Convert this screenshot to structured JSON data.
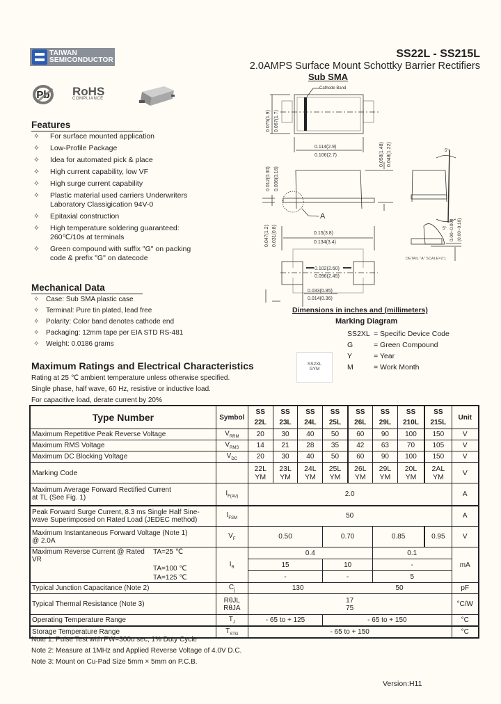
{
  "header": {
    "company_line1": "TAIWAN",
    "company_line2": "SEMICONDUCTOR",
    "part_range": "SS22L - SS215L",
    "description": "2.0AMPS Surface Mount Schottky Barrier Rectifiers",
    "package": "Sub SMA",
    "pb_free_icon": "Pb",
    "rohs": "RoHS",
    "rohs_sub": "COMPLIANCE"
  },
  "drawing": {
    "cathode_band": "Cathode Band",
    "dim_width_top": "0.114(2.9)",
    "dim_width_bot": "0.106(2.7)",
    "dim_height_top": "0.075(1.9)",
    "dim_height_bot": "0.067(1.7)",
    "dim_body_h_top": "0.058(1.48)",
    "dim_body_h_bot": "0.048(1.22)",
    "dim_lead_t_top": "0.012(0.30)",
    "dim_lead_t_bot": "0.006(0.16)",
    "detail_marker": "A",
    "angle_top": "5°",
    "angle_bot": "5°",
    "dim_len_top": "0.15(3.8)",
    "dim_len_bot": "0.134(3.4)",
    "dim_pad_top": "0.047(1.2)",
    "dim_pad_bot": "0.031(0.8)",
    "dim_inner_top": "0.102(2.60)",
    "dim_inner_bot": "0.096(2.45)",
    "dim_lead_top": "0.033(0.85)",
    "dim_lead_bot": "0.014(0.36)",
    "detail_dim_top": "0.00~0.004",
    "detail_dim_bot": "(0.00~0.10)",
    "detail_caption": "DETAIL \"A\" SCALE=2:1",
    "units_note": "Dimensions in inches and (millimeters)"
  },
  "features": {
    "heading": "Features",
    "items": [
      "For surface mounted application",
      "Low-Profile Package",
      "Idea for automated pick & place",
      "High current capability, low VF",
      "High surge current capability",
      "Plastic material used carriers Underwriters Laboratory Classigication 94V-0",
      "Epitaxial construction",
      "High temperature soldering guaranteed: 260℃/10s at terminals",
      "Green compound with suffix \"G\" on packing code & prefix \"G\" on datecode"
    ]
  },
  "mechanical": {
    "heading": "Mechanical Data",
    "items": [
      "Case: Sub SMA plastic case",
      "Terminal: Pure tin plated, lead free",
      "Polarity: Color band denotes cathode end",
      "Packaging: 12mm tape per EIA STD RS-481",
      "Weight: 0.0186 grams"
    ]
  },
  "marking": {
    "heading": "Marking Diagram",
    "chip_line1": "SS2XL",
    "chip_line2": "GYM",
    "legend": [
      {
        "code": "SS2XL",
        "meaning": "= Specific Device Code"
      },
      {
        "code": "G",
        "meaning": "= Green Compound"
      },
      {
        "code": "Y",
        "meaning": "= Year"
      },
      {
        "code": "M",
        "meaning": "= Work Month"
      }
    ]
  },
  "ratings": {
    "heading": "Maximum Ratings and Electrical Characteristics",
    "notes_top": [
      "Rating at 25 ℃ ambient temperature unless otherwise specified.",
      "Single phase, half wave, 60 Hz, resistive or inductive load.",
      "For capacitive load, derate current by 20%"
    ]
  },
  "table": {
    "type_header": "Type Number",
    "symbol_header": "Symbol",
    "unit_header": "Unit",
    "parts": [
      {
        "l1": "SS",
        "l2": "22L"
      },
      {
        "l1": "SS",
        "l2": "23L"
      },
      {
        "l1": "SS",
        "l2": "24L"
      },
      {
        "l1": "SS",
        "l2": "25L"
      },
      {
        "l1": "SS",
        "l2": "26L"
      },
      {
        "l1": "SS",
        "l2": "29L"
      },
      {
        "l1": "SS",
        "l2": "210L"
      },
      {
        "l1": "SS",
        "l2": "215L"
      }
    ],
    "vrrm": {
      "label": "Maximum Repetitive Peak Reverse Voltage",
      "sym": "V",
      "sub": "RRM",
      "values": [
        "20",
        "30",
        "40",
        "50",
        "60",
        "90",
        "100",
        "150"
      ],
      "unit": "V"
    },
    "vrms": {
      "label": "Maximum RMS Voltage",
      "sym": "V",
      "sub": "RMS",
      "values": [
        "14",
        "21",
        "28",
        "35",
        "42",
        "63",
        "70",
        "105"
      ],
      "unit": "V"
    },
    "vdc": {
      "label": "Maximum DC Blocking Voltage",
      "sym": "V",
      "sub": "DC",
      "values": [
        "20",
        "30",
        "40",
        "50",
        "60",
        "90",
        "100",
        "150"
      ],
      "unit": "V"
    },
    "marking": {
      "label": "Marking Code",
      "values": [
        [
          "22L",
          "YM"
        ],
        [
          "23L",
          "YM"
        ],
        [
          "24L",
          "YM"
        ],
        [
          "25L",
          "YM"
        ],
        [
          "26L",
          "YM"
        ],
        [
          "29L",
          "YM"
        ],
        [
          "20L",
          "YM"
        ],
        [
          "2AL",
          "YM"
        ]
      ],
      "unit": "V"
    },
    "ifav": {
      "label1": "Maximum Average Forward Rectified Current",
      "label2": "at TL (See Fig. 1)",
      "sym": "I",
      "sub": "F(AV)",
      "value": "2.0",
      "unit": "A"
    },
    "ifsm": {
      "label1": "Peak Forward Surge Current, 8.3 ms Single Half Sine-",
      "label2": "wave Superimposed on Rated Load (JEDEC method)",
      "sym": "I",
      "sub": "FSM",
      "value": "50",
      "unit": "A"
    },
    "vf": {
      "label1": "Maximum Instantaneous Forward Voltage (Note 1)",
      "label2": "@ 2.0A",
      "sym": "V",
      "sub": "F",
      "values": [
        "0.50",
        "0.70",
        "0.85",
        "0.95"
      ],
      "unit": "V"
    },
    "ir": {
      "label": "Maximum Reverse Current @ Rated VR",
      "t1": "TA=25 ℃",
      "t2": "TA=100 ℃",
      "t3": "TA=125 ℃",
      "sym": "I",
      "sub": "R",
      "r1": [
        "0.4",
        "0.1"
      ],
      "r2": [
        "15",
        "10",
        "-"
      ],
      "r3": [
        "-",
        "-",
        "5"
      ],
      "unit": "mA"
    },
    "cj": {
      "label": "Typical Junction Capacitance (Note 2)",
      "sym": "C",
      "sub": "j",
      "values": [
        "130",
        "50"
      ],
      "unit": "pF"
    },
    "rth": {
      "label": "Typical Thermal Resistance (Note 3)",
      "sym1": "RθJL",
      "sym2": "RθJA",
      "v1": "17",
      "v2": "75",
      "unit": "°C/W"
    },
    "tj": {
      "label": "Operating Temperature Range",
      "sym": "T",
      "sub": "J",
      "values": [
        "- 65 to + 125",
        "- 65 to + 150"
      ],
      "unit": "°C"
    },
    "tstg": {
      "label": "Storage Temperature Range",
      "sym": "T",
      "sub": "STG",
      "value": "- 65 to + 150",
      "unit": "°C"
    }
  },
  "notes": [
    "Note 1: Pulse Test with PW=300u sec, 1% Duty Cycle",
    "Note 2: Measure at 1MHz and Applied Reverse Voltage of 4.0V D.C.",
    "Note 3: Mount on Cu-Pad Size 5mm × 5mm on P.C.B."
  ],
  "version": "Version:H11"
}
